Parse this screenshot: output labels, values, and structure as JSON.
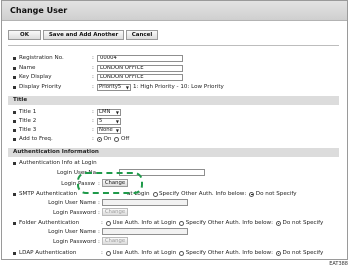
{
  "window": {
    "title": "Change User"
  },
  "toolbar": {
    "ok_label": "OK",
    "save_add_label": "Save and Add Another",
    "cancel_label": "Cancel"
  },
  "fields": {
    "registration_no": {
      "label": "Registration No.",
      "value": "00004"
    },
    "name": {
      "label": "Name",
      "value": "LONDON OFFICE"
    },
    "key_display": {
      "label": "Key Display",
      "value": "LONDON OFFICE"
    },
    "display_priority": {
      "label": "Display Priority",
      "value": "Priority5",
      "hint": "1: High Priority - 10: Low Priority"
    }
  },
  "title_section": {
    "header": "Title",
    "title1": {
      "label": "Title 1",
      "value": "LMN"
    },
    "title2": {
      "label": "Title 2",
      "value": "5"
    },
    "title3": {
      "label": "Title 3",
      "value": "None"
    },
    "add_to_freq": {
      "label": "Add to Freq.",
      "on": "On",
      "off": "Off",
      "selected": "on"
    }
  },
  "auth_section": {
    "header": "Authentication Information",
    "auth_login": {
      "label": "Authentication Info at Login",
      "user_label": "Login User Na",
      "password_label": "Login Passw",
      "change_label": "Change"
    },
    "smtp": {
      "label": "SMTP Authentication",
      "opt_login": "at Login",
      "opt_other": "Specify Other Auth. Info below",
      "opt_none": "Do not Specify",
      "user_label": "Login User Name",
      "password_label": "Login Password",
      "change_label": "Change"
    },
    "folder": {
      "label": "Folder Authentication",
      "opt_login": "Use Auth. Info at Login",
      "opt_other": "Specify Other Auth. Info below",
      "opt_none": "Do not Specify",
      "user_label": "Login User Name",
      "password_label": "Login Password",
      "change_label": "Change"
    },
    "ldap": {
      "label": "LDAP Authentication",
      "opt_login": "Use Auth. Info at Login",
      "opt_other": "Specify Other Auth. Info below",
      "opt_none": "Do not Specify"
    }
  },
  "footer": {
    "code": "EAT388"
  },
  "colors": {
    "highlight": "#1f9a4a",
    "section_bg": "#dcdcdc"
  }
}
